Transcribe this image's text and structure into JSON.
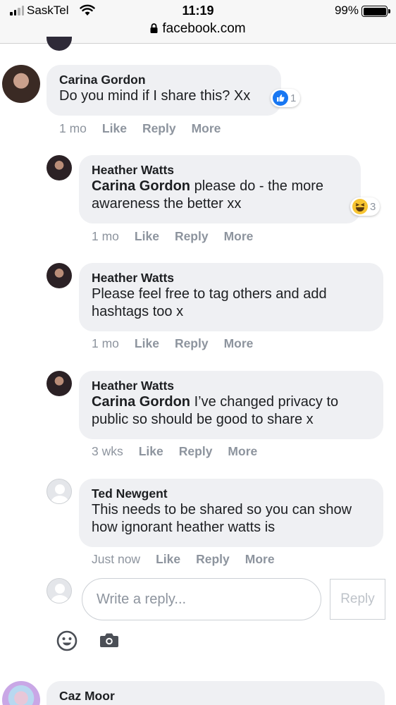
{
  "status_bar": {
    "carrier": "SaskTel",
    "time": "11:19",
    "battery": "99%",
    "url": "facebook.com"
  },
  "comments": [
    {
      "author": "Carina Gordon",
      "mention": "",
      "text": "Do you mind if I share this? Xx",
      "age": "1 mo",
      "reaction": {
        "type": "like",
        "count": "1"
      }
    },
    {
      "author": "Heather Watts",
      "mention": "Carina Gordon",
      "text": " please do - the more awareness the better xx",
      "age": "1 mo",
      "reaction": {
        "type": "haha",
        "count": "3"
      }
    },
    {
      "author": "Heather Watts",
      "mention": "",
      "text": "Please feel free to tag others and add hashtags too x",
      "age": "1 mo"
    },
    {
      "author": "Heather Watts",
      "mention": "Carina Gordon",
      "text": " I’ve changed privacy to public so should be good to share x",
      "age": "3 wks"
    },
    {
      "author": "Ted Newgent",
      "mention": "",
      "text": "This needs to be shared so you can show how ignorant heather watts is",
      "age": "Just now"
    },
    {
      "author": "Caz Moor",
      "mention": "",
      "text": ""
    }
  ],
  "action_labels": {
    "like": "Like",
    "reply": "Reply",
    "more": "More"
  },
  "composer": {
    "placeholder": "Write a reply...",
    "submit_label": "Reply"
  },
  "icons": {
    "emoji": "smiley-icon",
    "photo": "camera-icon"
  },
  "colors": {
    "bubble": "#eff0f3",
    "like_blue": "#1877f2",
    "muted": "#8d949e"
  }
}
